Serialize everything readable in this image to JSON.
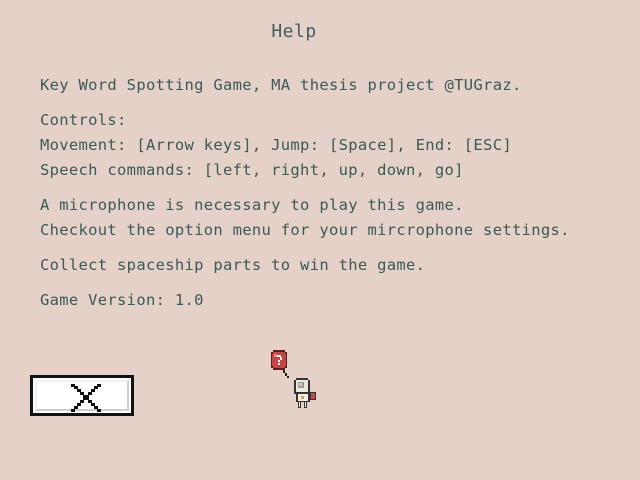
{
  "screen": {
    "title": "Help",
    "background_color": "#e6d1c8",
    "text_color": "#3a5a56"
  },
  "help": {
    "intro": "Key Word Spotting Game, MA thesis project @TUGraz.",
    "controls_heading": "Controls:",
    "movement": "Movement: [Arrow keys], Jump: [Space], End: [ESC]",
    "speech": "Speech commands: [left, right, up, down, go]",
    "mic_required": "A microphone is necessary to play this game.",
    "mic_settings": "Checkout the option menu for your mircrophone settings.",
    "objective": "Collect spaceship parts to win the game.",
    "version": "Game Version: 1.0"
  },
  "close_button": {
    "icon": "close-x-icon"
  },
  "character": {
    "icon": "astronaut-with-question-balloon"
  }
}
